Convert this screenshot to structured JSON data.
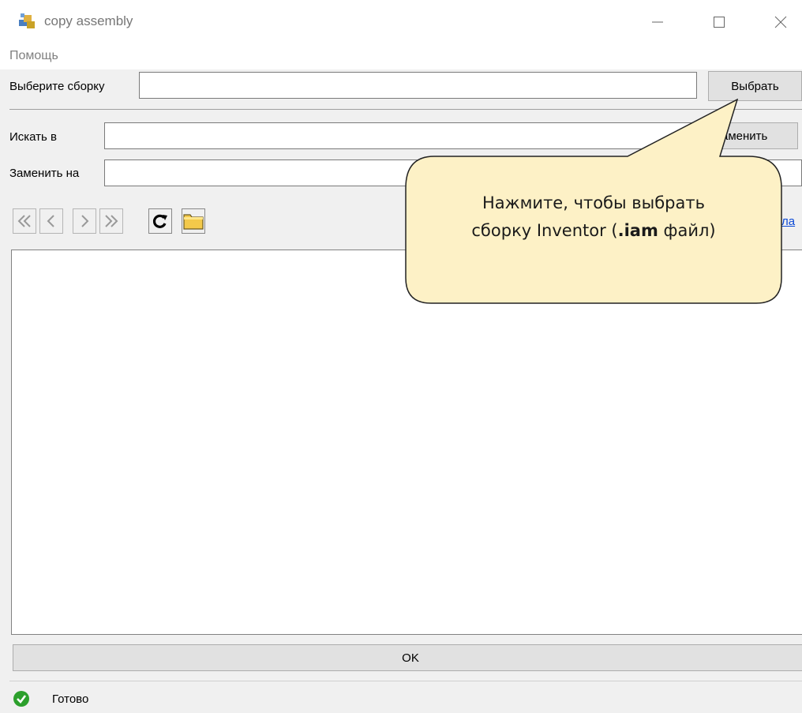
{
  "window": {
    "title": "copy assembly"
  },
  "menu": {
    "items": [
      "Помощь"
    ]
  },
  "assembly": {
    "label": "Выберите сборку",
    "value": "",
    "select_button": "Выбрать"
  },
  "search": {
    "label": "Искать в",
    "value": "",
    "replace_button": "Заменить",
    "replace_button_visible": "аменить"
  },
  "replace": {
    "label": "Заменить на",
    "value": ""
  },
  "toolbar": {
    "link_fragment": "ла"
  },
  "ok_button": "OK",
  "status": {
    "text": "Готово",
    "icon": "check-circle-icon",
    "color": "#2ca02c"
  },
  "callout": {
    "line1": "Нажмите, чтобы выбрать",
    "line2_prefix": "сборку Inventor (",
    "line2_bold": ".iam",
    "line2_suffix": " файл)"
  },
  "colors": {
    "callout_fill": "#fdf1c6",
    "link": "#0b49d6"
  }
}
